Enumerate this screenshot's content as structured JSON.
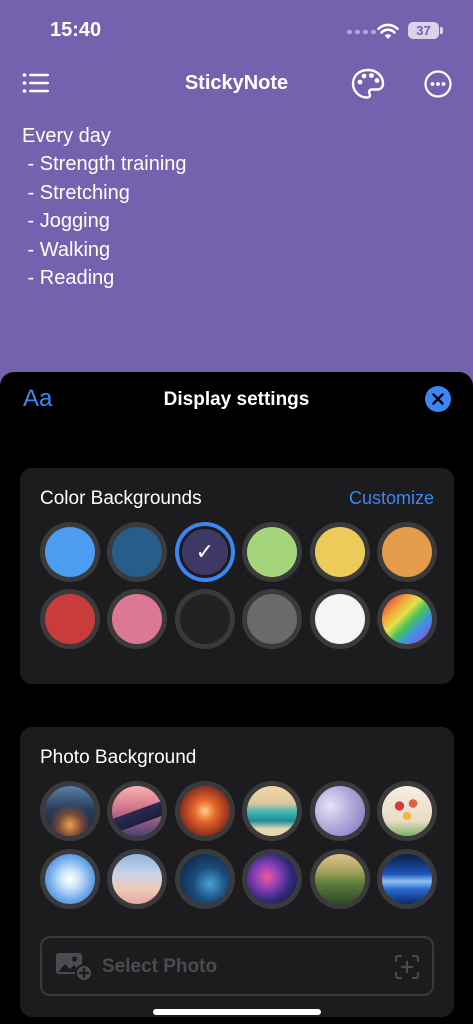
{
  "status_bar": {
    "time": "15:40",
    "battery": "37"
  },
  "nav": {
    "title": "StickyNote",
    "icons": {
      "menu": "list-icon",
      "palette": "palette-icon",
      "more": "more-icon"
    }
  },
  "note": {
    "lines": [
      "Every day",
      " - Strength training",
      " - Stretching",
      " - Jogging",
      " - Walking",
      " - Reading"
    ]
  },
  "sheet": {
    "font_button": "Aa",
    "title": "Display settings",
    "close_icon": "close-icon",
    "colors": {
      "title": "Color Backgrounds",
      "customize_label": "Customize",
      "selected_check": "✓",
      "selected_index": 2,
      "swatches": [
        "#4d9cf2",
        "#275d8a",
        "#3e3867",
        "#a4d57a",
        "#edcb5a",
        "#e39d4a",
        "#c83d3c",
        "#dc7794",
        "#222222",
        "#6a6a6a",
        "#f5f5f5",
        "rainbow"
      ]
    },
    "photos": {
      "title": "Photo Background",
      "select_label": "Select Photo",
      "thumbs": [
        "city-night",
        "mountain-sunset",
        "autumn-path",
        "beach-painting",
        "purple-clouds",
        "tulips",
        "blue-sky",
        "pastel-sky",
        "night-starry",
        "galaxy-nebula",
        "valley-river",
        "ocean-horizon"
      ]
    }
  },
  "colors": {
    "accent": "#3b86f2",
    "note_bg": "#7462ae",
    "sheet_bg": "#000000",
    "card_bg": "#1c1c1e"
  }
}
